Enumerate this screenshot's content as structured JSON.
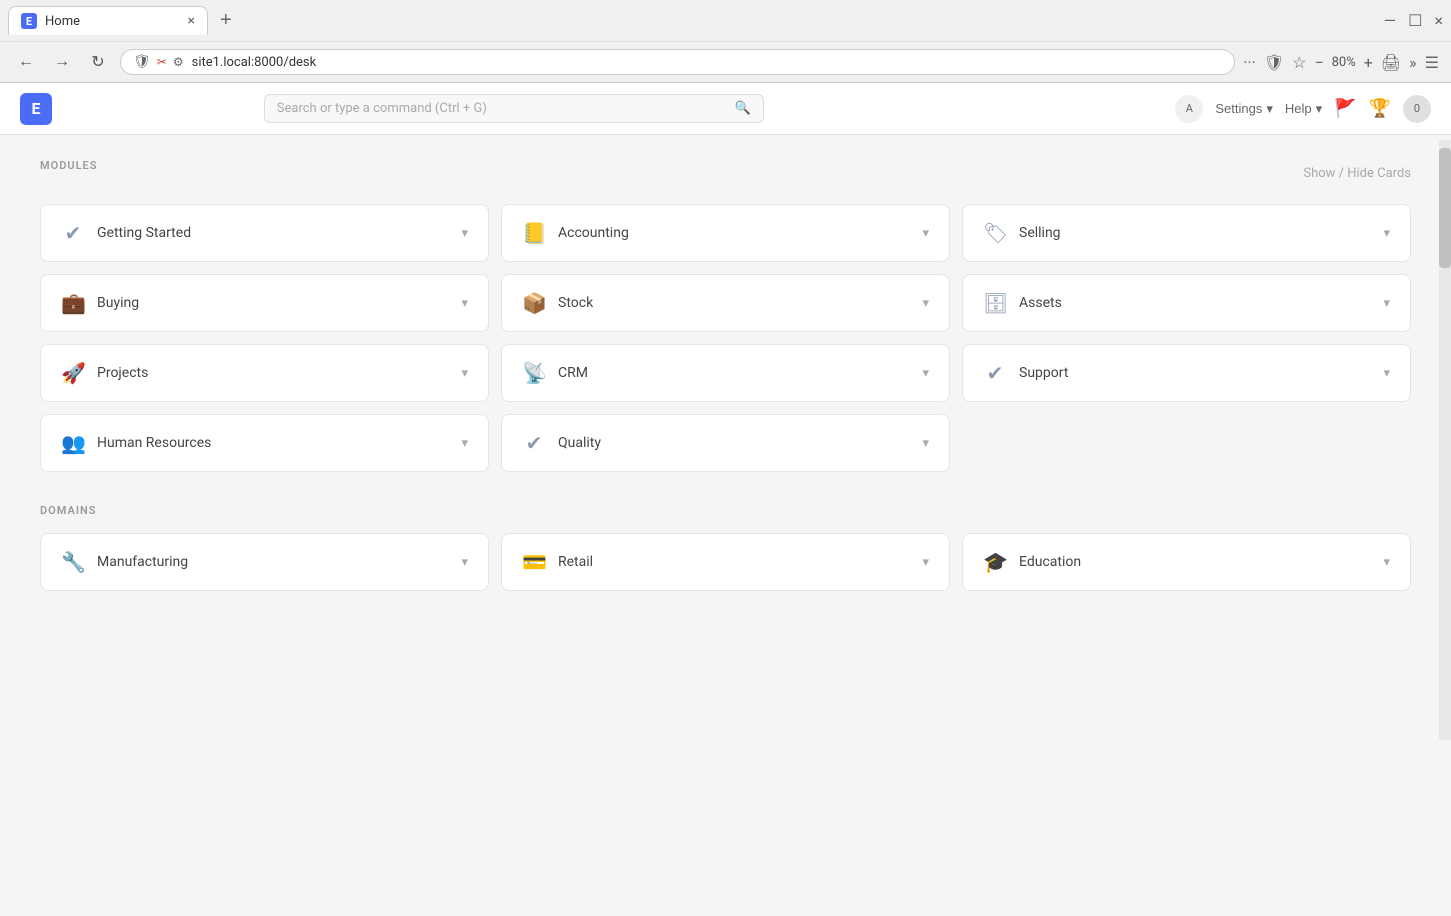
{
  "browser": {
    "tab_title": "Home",
    "tab_icon": "E",
    "close_label": "×",
    "new_tab_label": "+",
    "url": "site1.local:8000/desk",
    "zoom": "80%",
    "win_minimize": "—",
    "win_maximize": "☐",
    "win_close": "×"
  },
  "header": {
    "logo_text": "E",
    "search_placeholder": "Search or type a command (Ctrl + G)",
    "search_icon": "🔍",
    "lang_label": "A",
    "settings_label": "Settings",
    "settings_arrow": "▾",
    "help_label": "Help",
    "help_arrow": "▾",
    "notification_count": "0"
  },
  "modules_section": {
    "label": "MODULES",
    "show_hide_label": "Show / Hide Cards"
  },
  "domains_section": {
    "label": "DOMAINS"
  },
  "modules": [
    {
      "id": "getting-started",
      "name": "Getting Started",
      "icon": "✔"
    },
    {
      "id": "accounting",
      "name": "Accounting",
      "icon": "📒"
    },
    {
      "id": "selling",
      "name": "Selling",
      "icon": "🏷"
    },
    {
      "id": "buying",
      "name": "Buying",
      "icon": "💼"
    },
    {
      "id": "stock",
      "name": "Stock",
      "icon": "📦"
    },
    {
      "id": "assets",
      "name": "Assets",
      "icon": "🗄"
    },
    {
      "id": "projects",
      "name": "Projects",
      "icon": "🚀"
    },
    {
      "id": "crm",
      "name": "CRM",
      "icon": "📡"
    },
    {
      "id": "support",
      "name": "Support",
      "icon": "✔"
    },
    {
      "id": "human-resources",
      "name": "Human Resources",
      "icon": "👥"
    },
    {
      "id": "quality",
      "name": "Quality",
      "icon": "✔"
    }
  ],
  "domains": [
    {
      "id": "manufacturing",
      "name": "Manufacturing",
      "icon": "🔧"
    },
    {
      "id": "retail",
      "name": "Retail",
      "icon": "💳"
    },
    {
      "id": "education",
      "name": "Education",
      "icon": "🎓"
    }
  ]
}
